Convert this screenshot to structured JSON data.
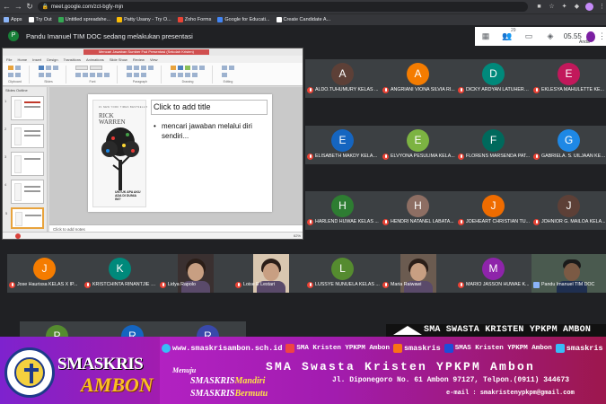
{
  "browser": {
    "url": "meet.google.com/zct-bgfy-mjn",
    "bookmarks": [
      {
        "label": "Apps",
        "color": "#8ab4f8"
      },
      {
        "label": "Try Out",
        "color": "#ffffff"
      },
      {
        "label": "Untitled spreadshe...",
        "color": "#34a853"
      },
      {
        "label": "Patty Usany - Try O...",
        "color": "#fbbc04"
      },
      {
        "label": "Zoho Forms",
        "color": "#ea4335"
      },
      {
        "label": "Google for Educati...",
        "color": "#4285f4"
      },
      {
        "label": "Create Candidate A...",
        "color": "#ffffff"
      }
    ]
  },
  "meet": {
    "presenter_initial": "P",
    "presenter_text": "Pandu Imanuel TIM DOC sedang melakukan presentasi",
    "participant_count": "29",
    "time": "05.55",
    "me_label": "Anda"
  },
  "slide": {
    "window_title": "Mencari Jawaban Sumber Fsd Presentasi (Sekolah Kristen)",
    "ribbon_tabs": [
      "File",
      "Home",
      "Insert",
      "Design",
      "Transitions",
      "Animations",
      "Slide Show",
      "Review",
      "View"
    ],
    "ribbon_groups": [
      "Clipboard",
      "Slides",
      "Font",
      "Paragraph",
      "Drawing",
      "Editing"
    ],
    "thumb_tabs": "Slides  Outline",
    "book_author_top": "#1 NEW YORK TIMES BESTSELLING AUTHOR",
    "book_author": "RICK WARREN",
    "book_title": "UNTUK APA AKU ADA DI DUNIA INI?",
    "title": "Click to add title",
    "bullet": "mencari jawaban melalui diri sendiri...",
    "notes": "Click to add notes",
    "zoom": "62%"
  },
  "participants": [
    {
      "initial": "A",
      "name": "ALDO.TUHUMURY KELAS ...",
      "color": "#5d4037"
    },
    {
      "initial": "A",
      "name": "ANGRIANI VIONA SILVIA RI...",
      "color": "#f57c00"
    },
    {
      "initial": "D",
      "name": "DICKY ARDYAN LATUHERU...",
      "color": "#00897b"
    },
    {
      "initial": "E",
      "name": "EKLESYA MAHULETTE KE...",
      "color": "#c2185b"
    },
    {
      "initial": "E",
      "name": "ELISABETH MAKDY KELAS ...",
      "color": "#1565c0"
    },
    {
      "initial": "E",
      "name": "ELVYONA PESULIMA KELA...",
      "color": "#7cb342"
    },
    {
      "initial": "F",
      "name": "FLORENS MARSENDA PAT...",
      "color": "#00695c"
    },
    {
      "initial": "G",
      "name": "GABRIELA. S. UILJAAN KEL...",
      "color": "#1e88e5"
    },
    {
      "initial": "H",
      "name": "HARLEND HUWAE KELAS ...",
      "color": "#2e7d32"
    },
    {
      "initial": "H",
      "name": "HENDRI NATANEL LABATA...",
      "color": "#8d6e63"
    },
    {
      "initial": "J",
      "name": "JOEHEART CHRISTIAN TU...",
      "color": "#ef6c00"
    },
    {
      "initial": "J",
      "name": "JOHNIOR G. MAILOA KELA...",
      "color": "#5d4037"
    },
    {
      "initial": "J",
      "name": "Jose Haurissa KELAS X IP...",
      "color": "#f57c00"
    },
    {
      "initial": "K",
      "name": "KRISTCHINTA RINANTJIE L...",
      "color": "#00897b"
    },
    {
      "initial": "",
      "name": "Lidya Rapolo",
      "color": "#000000"
    },
    {
      "initial": "",
      "name": "Loise E Lestari",
      "color": "#000000"
    },
    {
      "initial": "L",
      "name": "LUSSYE NUNUELA KELAS ...",
      "color": "#558b2f"
    },
    {
      "initial": "",
      "name": "Maria Raiwawi",
      "color": "#000000"
    },
    {
      "initial": "M",
      "name": "MARIO JASSON HUWAE K...",
      "color": "#8e24aa"
    },
    {
      "initial": "",
      "name": "Pandu Imanuel TIM DOC",
      "color": "#000000"
    },
    {
      "initial": "P",
      "name": "",
      "color": "#558b2f"
    },
    {
      "initial": "R",
      "name": "",
      "color": "#1565c0"
    },
    {
      "initial": "R",
      "name": "RUTH SUHUMURY KELAS ...",
      "color": "#3949ab"
    }
  ],
  "banner": {
    "logo_text": "SMASKRIS",
    "logo_sub": "AMBON",
    "menuju": "Menuju",
    "slogan1_a": "SMASKRIS",
    "slogan1_b": "Mandiri",
    "slogan2_a": "SMASKRIS",
    "slogan2_b": "Bermutu",
    "website": "www.smaskrisambon.sch.id",
    "youtube": "SMA Kristen YPKPM Ambon",
    "instagram": "smaskris",
    "facebook": "SMAS Kristen YPKPM Ambon",
    "twitter": "smaskris",
    "school_name": "SMA Swasta Kristen YPKPM Ambon",
    "address": "Jl. Diponegoro  No. 61 Ambon 97127, Telpon.(0911) 344673",
    "email": "e-mail : smakristenypkpm@gmail.com",
    "stripe_text": "SMA SWASTA KRISTEN YPKPM AMBON"
  }
}
